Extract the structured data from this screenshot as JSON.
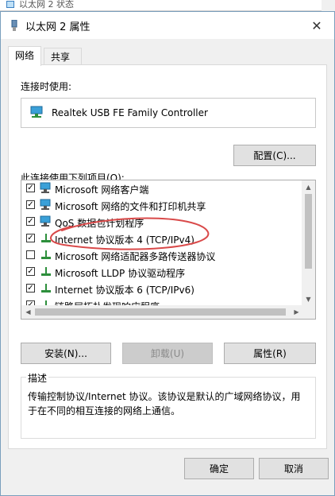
{
  "back_window": {
    "title": "以太网 2 状态"
  },
  "dialog": {
    "title": "以太网 2 属性",
    "close_glyph": "✕"
  },
  "tabs": [
    {
      "label": "网络",
      "active": true
    },
    {
      "label": "共享",
      "active": false
    }
  ],
  "connect_using": {
    "label": "连接时使用:",
    "adapter": "Realtek USB FE Family Controller",
    "configure_button": "配置(C)..."
  },
  "items_section": {
    "label": "此连接使用下列项目(O):",
    "items": [
      {
        "label": "Microsoft 网络客户端",
        "checked": true,
        "icon": "network-client-icon"
      },
      {
        "label": "Microsoft 网络的文件和打印机共享",
        "checked": true,
        "icon": "network-client-icon"
      },
      {
        "label": "QoS 数据包计划程序",
        "checked": true,
        "icon": "network-client-icon"
      },
      {
        "label": "Internet 协议版本 4 (TCP/IPv4)",
        "checked": true,
        "icon": "protocol-icon"
      },
      {
        "label": "Microsoft 网络适配器多路传送器协议",
        "checked": false,
        "icon": "protocol-icon"
      },
      {
        "label": "Microsoft LLDP 协议驱动程序",
        "checked": true,
        "icon": "protocol-icon"
      },
      {
        "label": "Internet 协议版本 6 (TCP/IPv6)",
        "checked": true,
        "icon": "protocol-icon"
      },
      {
        "label": "链路层拓扑发现响应程序",
        "checked": true,
        "icon": "protocol-icon"
      }
    ],
    "scroll_up": "▲",
    "scroll_down": "▼",
    "scroll_left": "◀",
    "scroll_right": "▶"
  },
  "action_buttons": {
    "install": "安装(N)...",
    "uninstall": "卸载(U)",
    "properties": "属性(R)"
  },
  "description": {
    "legend": "描述",
    "text": "传输控制协议/Internet 协议。该协议是默认的广域网络协议，用于在不同的相互连接的网络上通信。"
  },
  "footer": {
    "ok": "确定",
    "cancel": "取消"
  },
  "colors": {
    "accent": "#3a7fc2",
    "annotation": "#d94a4a"
  }
}
